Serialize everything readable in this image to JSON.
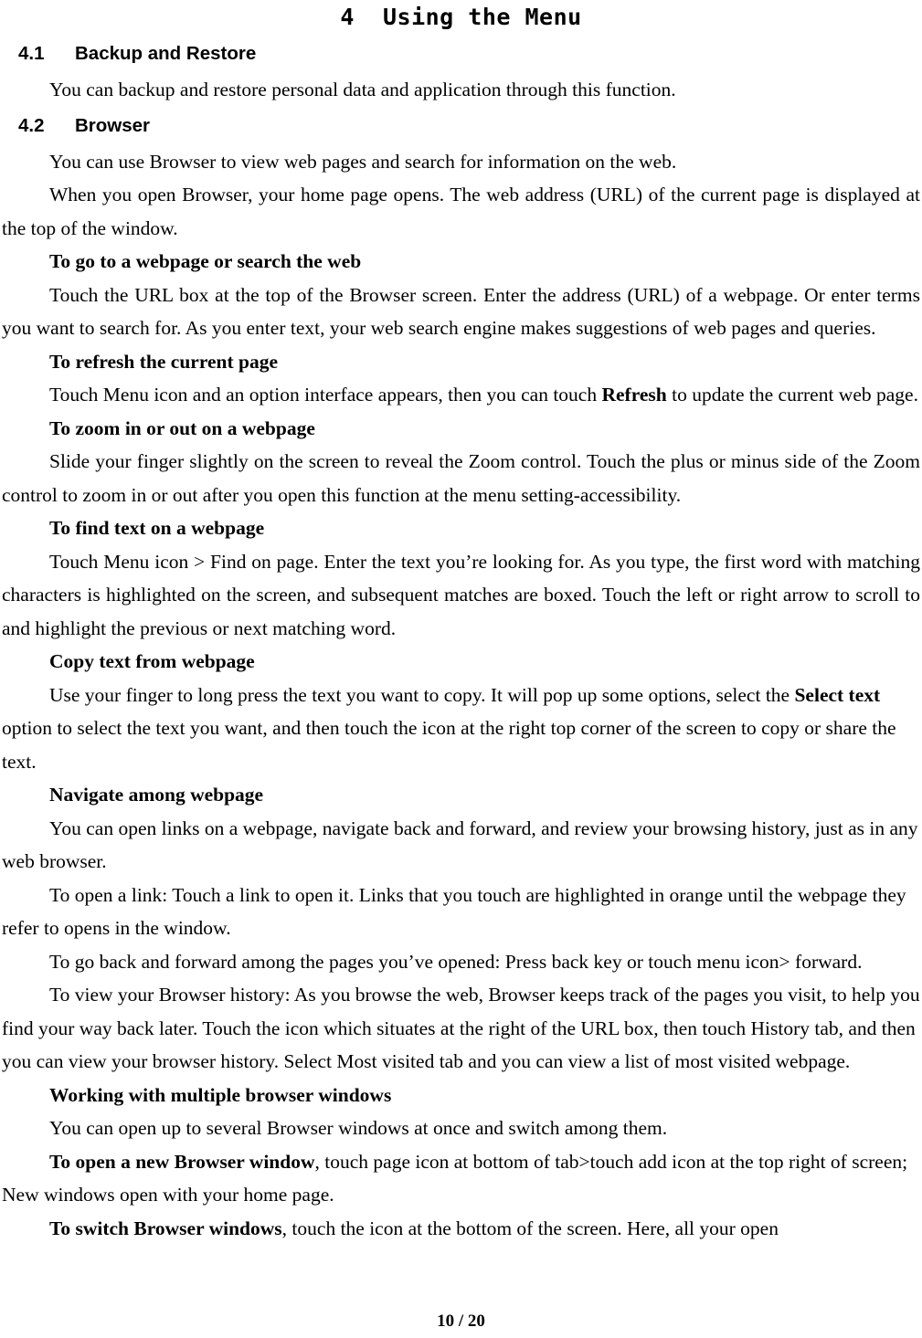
{
  "document": {
    "chapter_title": "4  Using the Menu",
    "footer": "10 / 20"
  },
  "sections": [
    {
      "number": "4.1",
      "title": "Backup and Restore",
      "intro": "You can backup and restore personal data and application through this function."
    },
    {
      "number": "4.2",
      "title": "Browser"
    }
  ],
  "browser": {
    "p_intro_1": "You can use Browser to view web pages and search for information on the web.",
    "p_intro_2": "When you open Browser, your home page opens. The web address (URL) of the current page is displayed at the top of the window.",
    "h_goto": "To go to a webpage or search the web",
    "p_goto": "Touch the URL box at the top of the Browser screen. Enter the address (URL) of a webpage. Or enter terms you want to search for. As you enter text, your web search engine makes suggestions of web pages and queries.",
    "h_refresh": "To refresh the current page",
    "p_refresh_a": "Touch Menu icon and an option interface appears, then you can touch ",
    "p_refresh_bold": "Refresh",
    "p_refresh_b": " to update the current web page.",
    "h_zoom": "To zoom in or out on a webpage",
    "p_zoom": "Slide your finger slightly on the screen to reveal the Zoom control. Touch the plus or minus side of the Zoom control to zoom in or out after you open this function at the menu setting-accessibility.",
    "h_find": "To find text on a webpage",
    "p_find": "Touch Menu icon > Find on page. Enter the text you’re looking for. As you type, the first word with matching characters is highlighted on the screen, and subsequent matches are boxed. Touch the left or right arrow to scroll to and highlight the previous or next matching word.",
    "h_copy": "Copy text from webpage",
    "p_copy_a": "Use your finger to long press the text you want to copy. It will pop up some options, select the ",
    "p_copy_bold": "Select text",
    "p_copy_b": " option to select the text you want, and then touch the icon at the right top corner of the screen to copy or share the text.",
    "h_navigate": "Navigate among webpage",
    "p_nav_1": "You can open links on a webpage, navigate back and forward, and review your browsing history, just as in any web browser.",
    "p_nav_2": "To open a link: Touch a link to open it. Links that you touch are highlighted in orange until the webpage they refer to opens in the window.",
    "p_nav_3": "To go back and forward among the pages you’ve opened: Press back key or touch menu icon> forward.",
    "p_nav_4": "To view your Browser history: As you browse the web, Browser keeps track of the pages you visit, to help you find your way back later. Touch the icon which situates at the right of the URL box, then touch History tab, and then you can view your browser history. Select Most visited tab and you can view a list of most visited webpage.",
    "h_multiple": "Working with multiple browser windows",
    "p_multiple": "You can open up to several Browser windows at once and switch among them.",
    "p_open_new_bold": "To open a new Browser window",
    "p_open_new": ", touch page icon at bottom of tab>touch add icon at the top right of screen; New windows open with your home page.",
    "p_switch_bold": "To switch Browser windows",
    "p_switch": ", touch the icon at the bottom of the screen. Here, all your open"
  }
}
